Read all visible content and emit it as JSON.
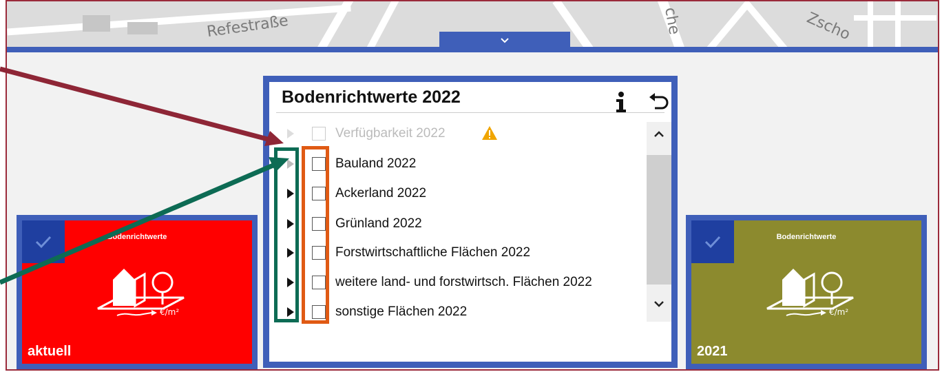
{
  "map": {
    "streets": [
      "Refestraße",
      "Zscho",
      "che"
    ],
    "collapse_tab": "chevron-down-icon"
  },
  "panel": {
    "title": "Bodenrichtwerte 2022",
    "icons": {
      "info": "info-icon",
      "back": "back-arrow-icon",
      "up": "chevron-up-icon",
      "down": "chevron-down-icon"
    },
    "layers": [
      {
        "label": "Verfügbarkeit 2022",
        "disabled": true,
        "warning": true
      },
      {
        "label": "Bauland 2022",
        "disabled": false
      },
      {
        "label": "Ackerland 2022",
        "disabled": false
      },
      {
        "label": "Grünland 2022",
        "disabled": false
      },
      {
        "label": "Forstwirtschaftliche Flächen 2022",
        "disabled": false
      },
      {
        "label": "weitere land- und forstwirtsch. Flächen 2022",
        "disabled": false
      },
      {
        "label": "sonstige Flächen 2022",
        "disabled": false
      }
    ]
  },
  "cards": [
    {
      "title": "Bodenrichtwerte",
      "year": "aktuell",
      "unit": "€/m²",
      "color": "#ff0000",
      "checked": true
    },
    {
      "title": "Bodenrichtwerte",
      "year": "2021",
      "unit": "€/m²",
      "color": "#8c8a2e",
      "checked": true
    }
  ],
  "colors": {
    "accent": "#3f5fb9",
    "frame": "#9a2a3a",
    "annotation_green": "#0d6b54",
    "annotation_orange": "#e05a14",
    "annotation_arrow": "#8e2636"
  }
}
